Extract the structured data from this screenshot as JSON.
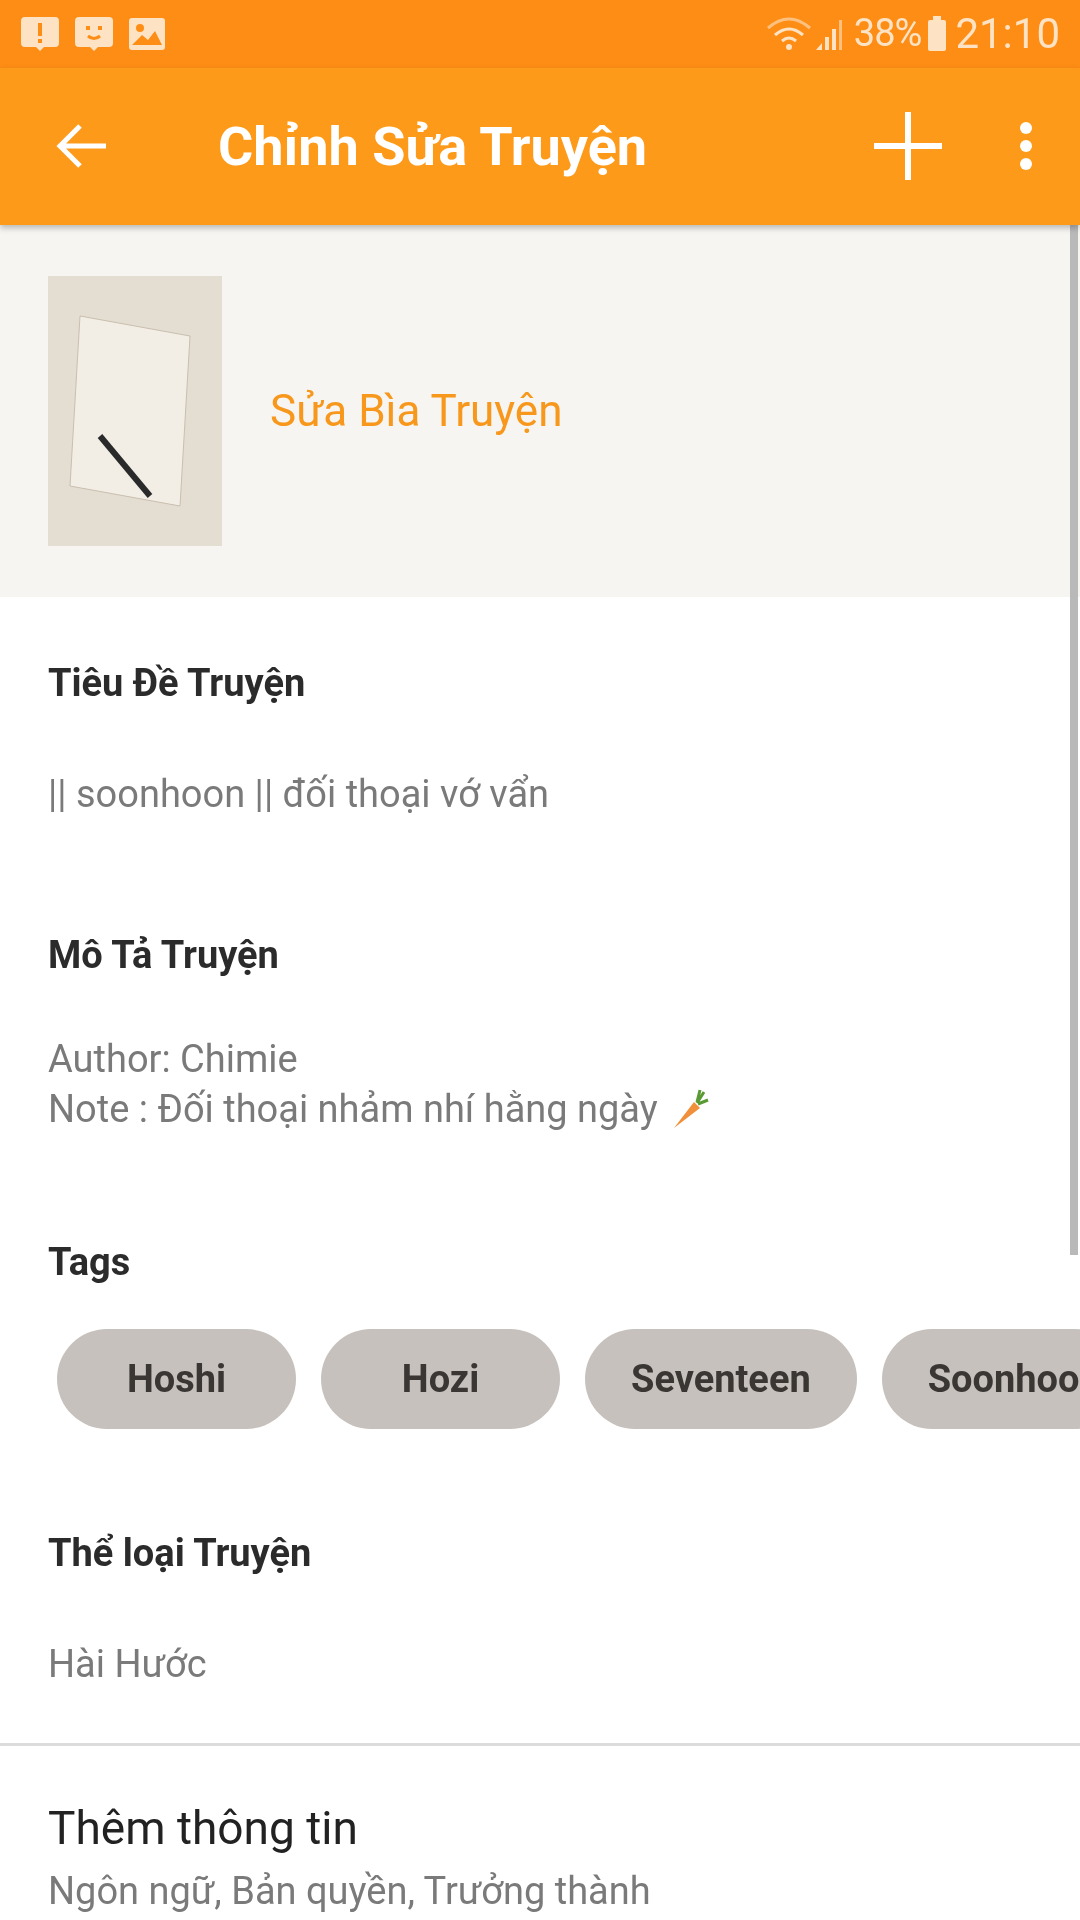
{
  "status_bar": {
    "battery": "38%",
    "time": "21:10"
  },
  "app_bar": {
    "title": "Chỉnh Sửa Truyện"
  },
  "cover": {
    "action": "Sửa Bìa Truyện"
  },
  "title_section": {
    "label": "Tiêu Đề Truyện",
    "value": "|| soonhoon || đối thoại vớ vẩn"
  },
  "description_section": {
    "label": "Mô Tả Truyện",
    "lines": [
      "Author: Chimie",
      "Note : Đối thoại nhảm nhí hằng ngày"
    ]
  },
  "tags_section": {
    "label": "Tags",
    "tags": [
      "Hoshi",
      "Hozi",
      "Seventeen",
      "Soonhoo"
    ]
  },
  "genre_section": {
    "label": "Thể loại Truyện",
    "value": "Hài Hước"
  },
  "more_info": {
    "title": "Thêm thông tin",
    "subtitle": "Ngôn ngữ, Bản quyền, Trưởng thành"
  }
}
